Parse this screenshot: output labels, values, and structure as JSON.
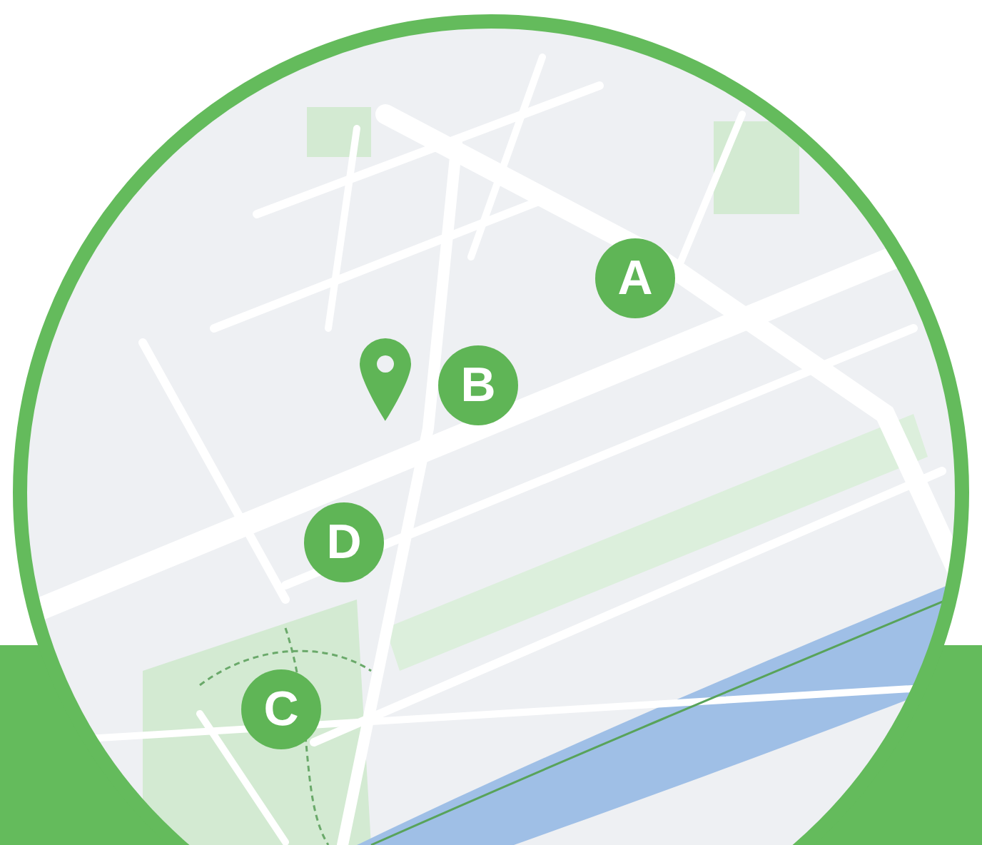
{
  "map": {
    "markers": [
      {
        "label": "A"
      },
      {
        "label": "B"
      },
      {
        "label": "D"
      },
      {
        "label": "C"
      }
    ]
  }
}
